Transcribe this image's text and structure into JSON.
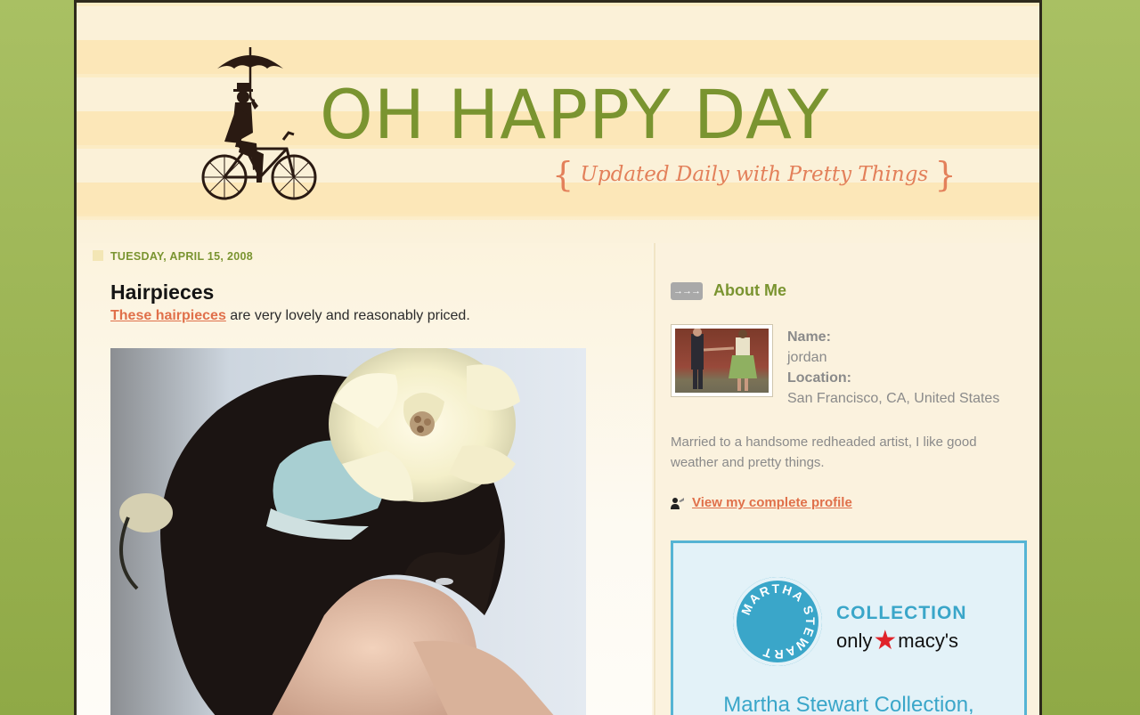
{
  "header": {
    "title": "OH HAPPY DAY",
    "tagline": "Updated Daily with Pretty Things",
    "brace_left": "{",
    "brace_right": "}"
  },
  "post": {
    "date": "TUESDAY, APRIL 15, 2008",
    "title": "Hairpieces",
    "link_text": "These hairpieces",
    "body_rest": " are very lovely and reasonably priced."
  },
  "sidebar": {
    "about_heading": "About Me",
    "arrow_glyph": "→→→",
    "name_label": "Name:",
    "name_value": "jordan",
    "location_label": "Location:",
    "location_value": "San Francisco, CA, United States",
    "description": "Married to a handsome redheaded artist, I like good weather and pretty things.",
    "profile_link": "View my complete profile"
  },
  "ad": {
    "seal_text": "MARTHA STEWART",
    "collection": "COLLECTION",
    "only": "only",
    "macys": "macy's",
    "caption": "Martha Stewart Collection,"
  },
  "colors": {
    "page_background": "#9bb55a",
    "title_green": "#7a9430",
    "accent_orange": "#e0704a",
    "ad_blue": "#3aa6c9"
  }
}
